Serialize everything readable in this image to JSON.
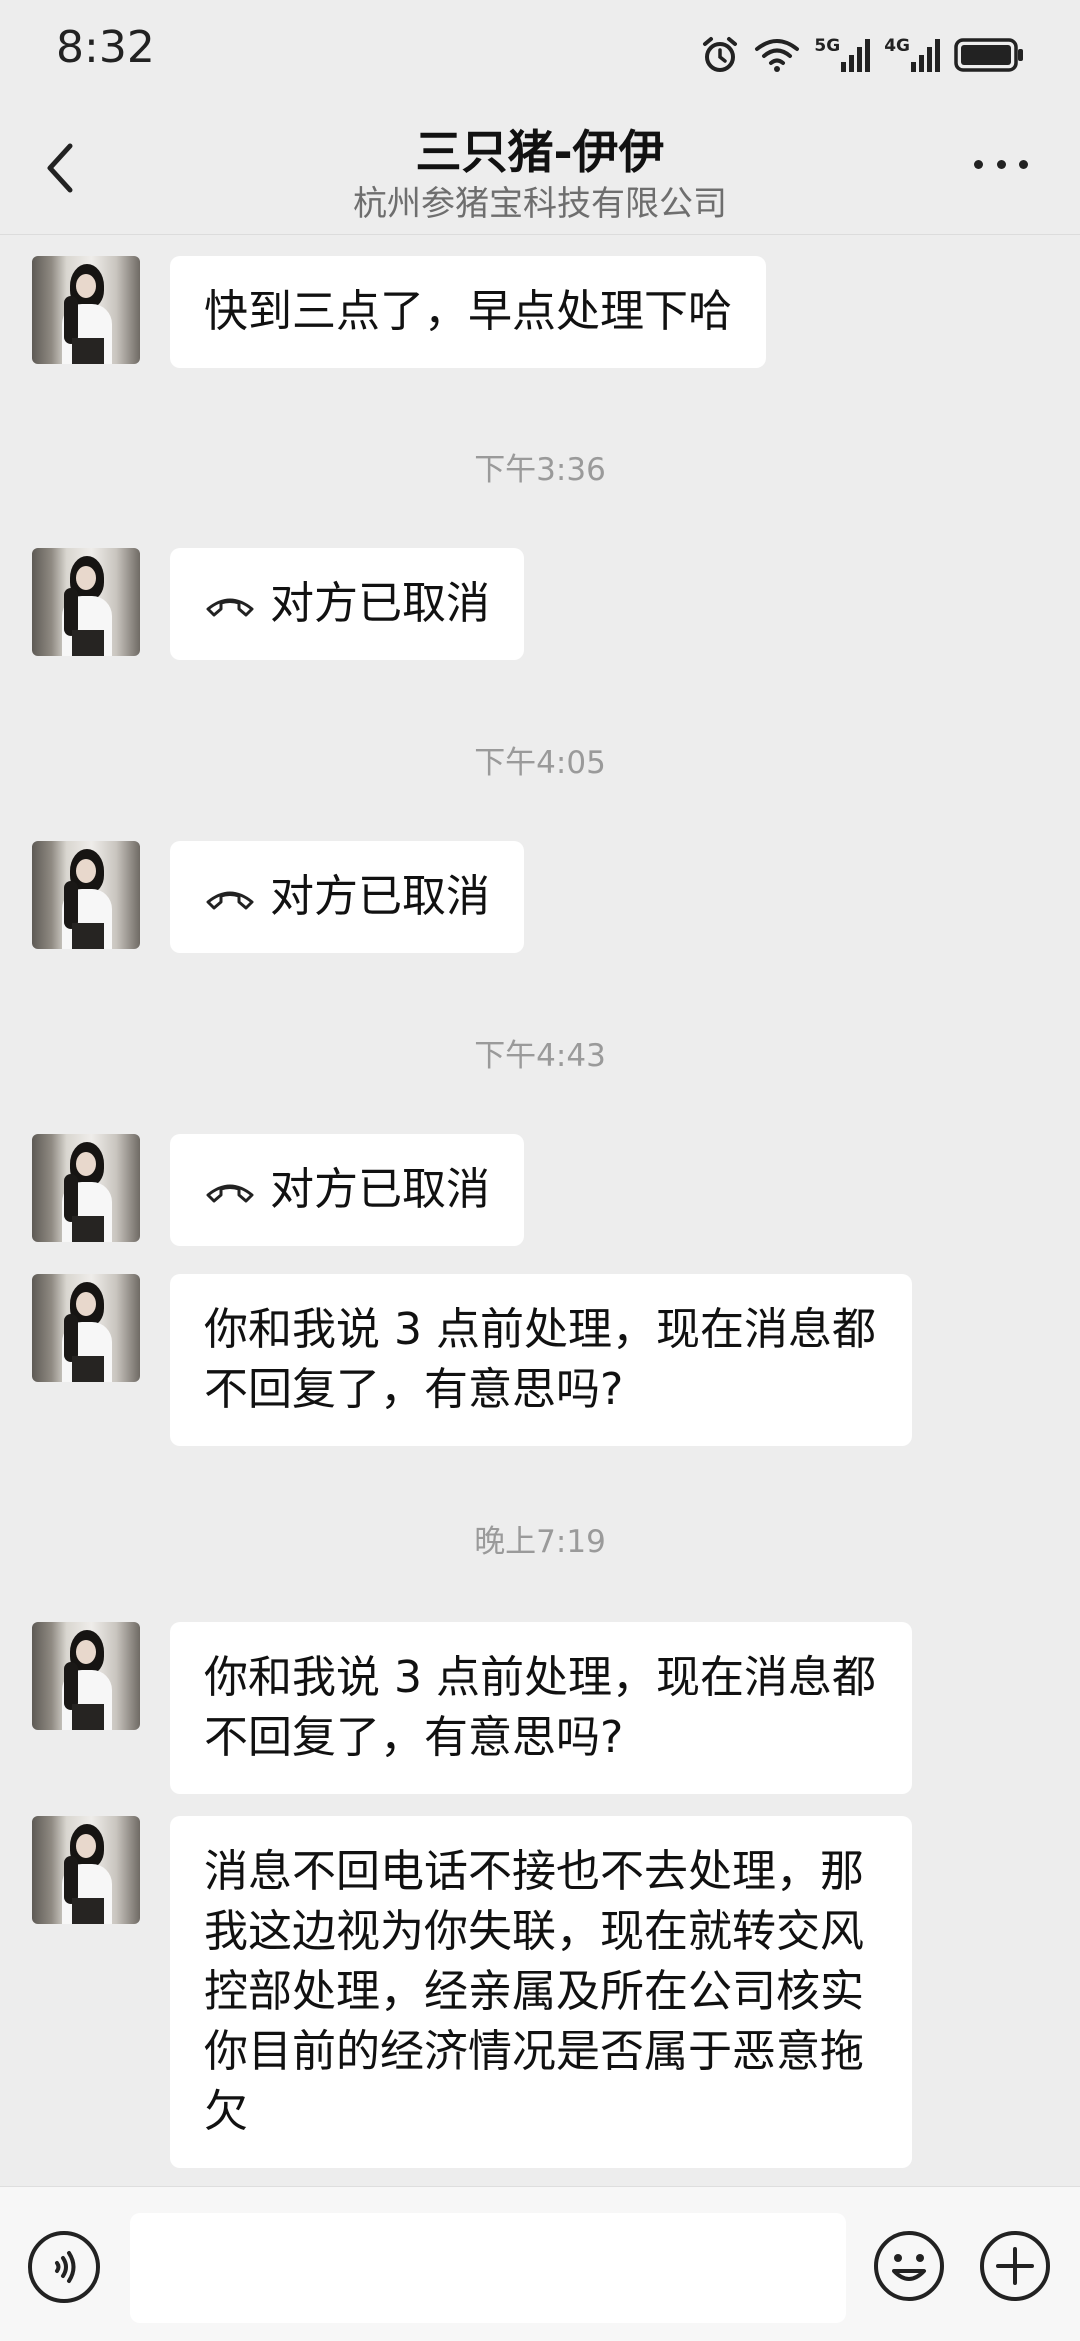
{
  "status_bar": {
    "time": "8:32",
    "network_5g": "5G",
    "network_4g": "4G"
  },
  "header": {
    "title": "三只猪-伊伊",
    "subtitle": "杭州参猪宝科技有限公司",
    "back_icon": "chevron-left-icon",
    "more_icon": "more-dots-icon"
  },
  "messages": [
    {
      "type": "text",
      "lines": [
        "快到三点了，早点处理下哈"
      ]
    },
    {
      "type": "timestamp",
      "text": "下午3:36"
    },
    {
      "type": "call",
      "text": "对方已取消"
    },
    {
      "type": "timestamp",
      "text": "下午4:05"
    },
    {
      "type": "call",
      "text": "对方已取消"
    },
    {
      "type": "timestamp",
      "text": "下午4:43"
    },
    {
      "type": "call",
      "text": "对方已取消"
    },
    {
      "type": "text",
      "lines": [
        "你和我说 3 点前处理，现在消息都",
        "不回复了，有意思吗?"
      ]
    },
    {
      "type": "timestamp",
      "text": "晚上7:19"
    },
    {
      "type": "text",
      "lines": [
        "你和我说 3 点前处理，现在消息都",
        "不回复了，有意思吗?"
      ]
    },
    {
      "type": "text",
      "lines": [
        "消息不回电话不接也不去处理，那",
        "我这边视为你失联，现在就转交风",
        "控部处理，经亲属及所在公司核实",
        "你目前的经济情况是否属于恶意拖",
        "欠"
      ]
    }
  ],
  "input_bar": {
    "voice_icon": "voice-icon",
    "emoji_icon": "emoji-icon",
    "plus_icon": "plus-icon",
    "placeholder": ""
  }
}
